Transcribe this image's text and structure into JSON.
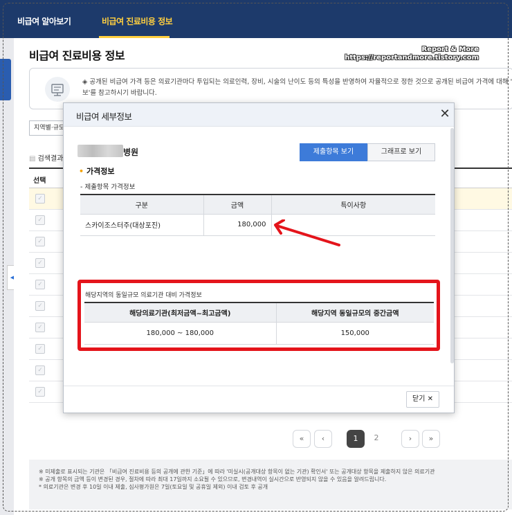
{
  "nav": {
    "tabs": [
      {
        "label": "비급여 알아보기"
      },
      {
        "label": "비급여 진료비용 정보"
      }
    ]
  },
  "page": {
    "title": "비급여 진료비용 정보",
    "notice": "◈ 공개된 비급여 가격 등은 의료기관마다 투입되는 의료인력, 장비, 시술의 난이도 등의 특성을 반영하여 자율적으로 정한 것으로 공개된 비급여 가격에 대해 '",
    "notice_line2": "보'를 참고하시기 바랍니다.",
    "region_select": "지역별·규모별",
    "search_result": "검색결과",
    "column_select": "선택"
  },
  "watermark": {
    "line1": "Report & More",
    "line2": "https://reportandmore.tistory.com"
  },
  "modal": {
    "title": "비급여 세부정보",
    "hospital_suffix": "병원",
    "view_buttons": {
      "items": "제출항목 보기",
      "graph": "그래프로 보기"
    },
    "section_price": "가격정보",
    "sub_price": "- 제출항목 가격정보",
    "price_table": {
      "headers": [
        "구분",
        "금액",
        "특이사항"
      ],
      "rows": [
        {
          "category": "스카이조스터주(대상포진)",
          "amount": "180,000",
          "note": ""
        }
      ]
    },
    "compare": {
      "caption": "해당지역의 동일규모 의료기관 대비 가격정보",
      "headers": [
        "해당의료기관(최저금액~최고금액)",
        "해당지역 동일규모의 중간금액"
      ],
      "row": [
        "180,000 ~ 180,000",
        "150,000"
      ]
    },
    "close_label": "닫기",
    "close_icon": "close-icon"
  },
  "pagination": {
    "first": "«",
    "prev": "‹",
    "pages": [
      "1",
      "2"
    ],
    "current": "1",
    "next": "›",
    "last": "»"
  },
  "footnotes": [
    "※ 미제출로 표시되는 기관은 「비급여 진료비용 등의 공개에 관한 기준」에 따라 '미실시(공개대상 항목이 없는 기관) 확인서' 또는 공개대상 항목을 제출하지 않은 의료기관",
    "※ 공개 항목의 금액 등이 변경된 경우, 절차에 따라 최대 17일까지 소요될 수 있으므로, 변경내역이 실시간으로 반영되지 않을 수 있음을 알려드립니다.",
    "* 의료기관은 변경 후 10일 이내 제출, 심사평가원은 7일(토요일 및 공휴일 제외) 이내 검토 후 공개"
  ],
  "colors": {
    "nav_bg": "#1d3a6b",
    "nav_active": "#ffcf3f",
    "accent_blue": "#3d7bd9",
    "highlight_red": "#e4141b"
  }
}
